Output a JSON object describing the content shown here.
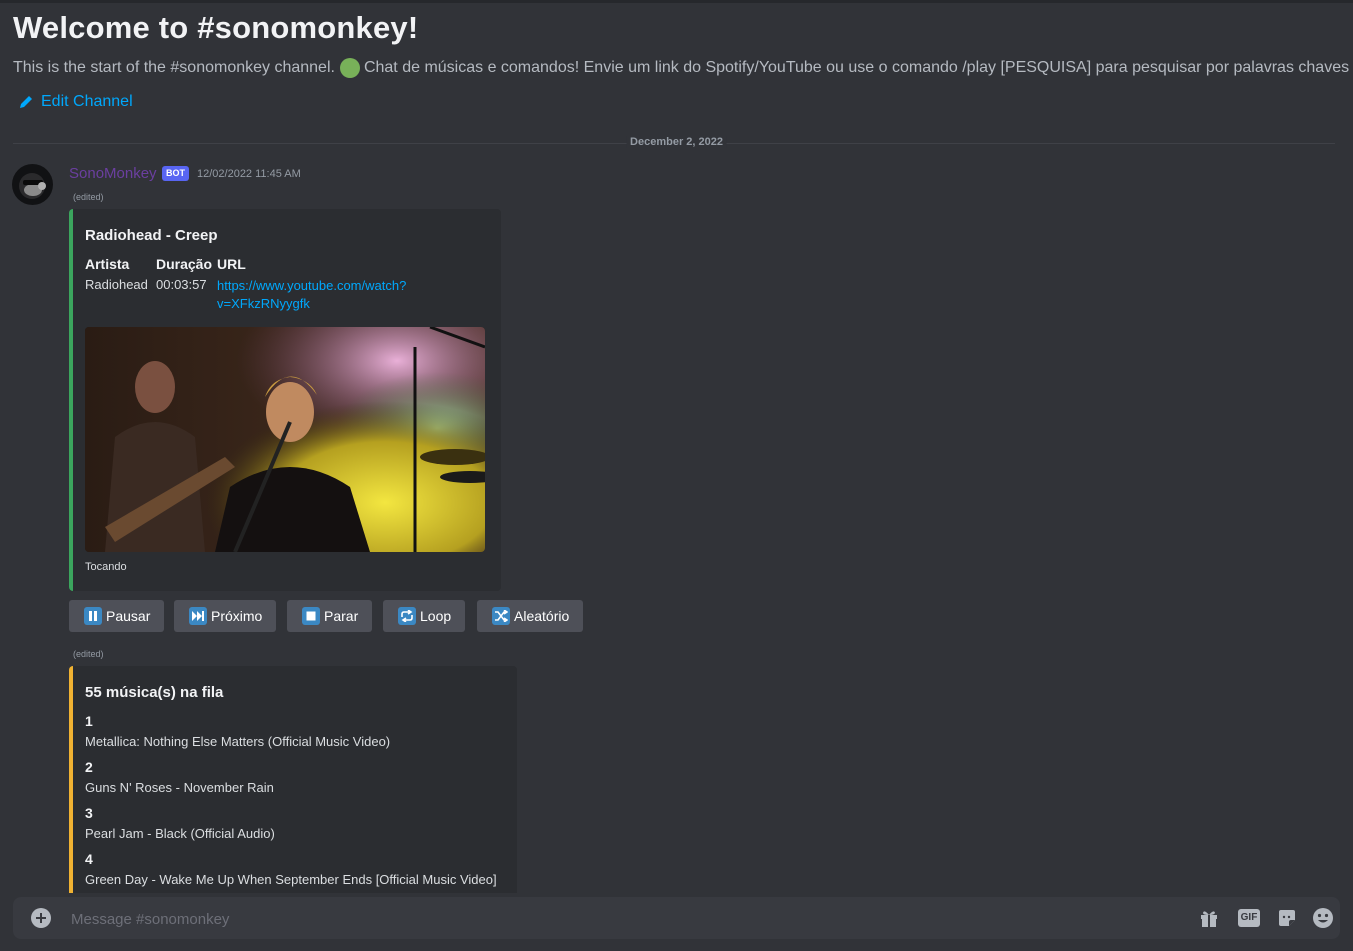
{
  "channel": {
    "welcome_title": "Welcome to #sonomonkey!",
    "description_prefix": "This is the start of the #sonomonkey channel.",
    "description_text": "Chat de músicas e comandos! Envie um link do Spotify/YouTube ou use o comando /play [PESQUISA] para pesquisar por palavras chaves",
    "edit_label": "Edit Channel",
    "date_divider": "December 2, 2022"
  },
  "message": {
    "author": "SonoMonkey",
    "bot_tag": "BOT",
    "timestamp": "12/02/2022 11:45 AM",
    "edited_label": "(edited)",
    "author_color": "#6b3fa0"
  },
  "now_playing": {
    "title": "Radiohead - Creep",
    "fields": [
      {
        "name": "Artista",
        "value": "Radiohead"
      },
      {
        "name": "Duração",
        "value": "00:03:57"
      },
      {
        "name": "URL",
        "value_line1": "https://www.youtube.com/watch?",
        "value_line2": "v=XFkzRNyygfk"
      }
    ],
    "footer": "Tocando",
    "accent": "#3ba55d"
  },
  "controls": [
    {
      "label": "Pausar",
      "icon": "pause-icon"
    },
    {
      "label": "Próximo",
      "icon": "next-track-icon"
    },
    {
      "label": "Parar",
      "icon": "stop-icon"
    },
    {
      "label": "Loop",
      "icon": "loop-icon"
    },
    {
      "label": "Aleatório",
      "icon": "shuffle-icon"
    }
  ],
  "queue": {
    "edited_label": "(edited)",
    "title": "55 música(s) na fila",
    "accent": "#f0b232",
    "items": [
      {
        "num": "1",
        "title": "Metallica: Nothing Else Matters (Official Music Video)"
      },
      {
        "num": "2",
        "title": "Guns N' Roses - November Rain"
      },
      {
        "num": "3",
        "title": "Pearl Jam - Black (Official Audio)"
      },
      {
        "num": "4",
        "title": "Green Day - Wake Me Up When September Ends [Official Music Video]"
      }
    ]
  },
  "composer": {
    "placeholder": "Message #sonomonkey",
    "gif_label": "GIF"
  }
}
